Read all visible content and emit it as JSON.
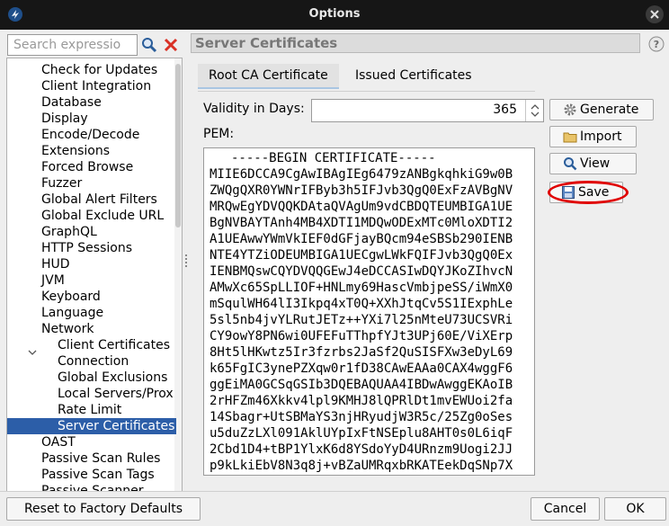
{
  "window": {
    "title": "Options"
  },
  "search": {
    "placeholder": "Search expressio"
  },
  "tree": {
    "items": [
      {
        "label": "Check for Updates"
      },
      {
        "label": "Client Integration"
      },
      {
        "label": "Database"
      },
      {
        "label": "Display"
      },
      {
        "label": "Encode/Decode"
      },
      {
        "label": "Extensions"
      },
      {
        "label": "Forced Browse"
      },
      {
        "label": "Fuzzer"
      },
      {
        "label": "Global Alert Filters"
      },
      {
        "label": "Global Exclude URL"
      },
      {
        "label": "GraphQL"
      },
      {
        "label": "HTTP Sessions"
      },
      {
        "label": "HUD"
      },
      {
        "label": "JVM"
      },
      {
        "label": "Keyboard"
      },
      {
        "label": "Language"
      },
      {
        "label": "Network",
        "expanded": true
      },
      {
        "label": "Client Certificates"
      },
      {
        "label": "Connection"
      },
      {
        "label": "Global Exclusions"
      },
      {
        "label": "Local Servers/Prox"
      },
      {
        "label": "Rate Limit"
      },
      {
        "label": "Server Certificates",
        "selected": true
      },
      {
        "label": "OAST"
      },
      {
        "label": "Passive Scan Rules"
      },
      {
        "label": "Passive Scan Tags"
      },
      {
        "label": "Passive Scanner"
      }
    ]
  },
  "panel": {
    "title": "Server Certificates",
    "tabs": [
      {
        "label": "Root CA Certificate",
        "active": true
      },
      {
        "label": "Issued Certificates",
        "active": false
      }
    ],
    "validity_label": "Validity in Days:",
    "validity_value": "365",
    "pem_label": "PEM:",
    "pem_lines": [
      "-----BEGIN CERTIFICATE-----",
      "MIIE6DCCA9CgAwIBAgIEg6479zANBgkqhkiG9w0B",
      "ZWQgQXR0YWNrIFByb3h5IFJvb3QgQ0ExFzAVBgNV",
      "MRQwEgYDVQQKDAtaQVAgUm9vdCBDQTEUMBIGA1UE",
      "BgNVBAYTAnh4MB4XDTI1MDQwODExMTc0MloXDTI2",
      "A1UEAwwYWmVkIEF0dGFjayBQcm94eSBSb290IENB",
      "NTE4YTZiODEUMBIGA1UECgwLWkFQIFJvb3QgQ0Ex",
      "IENBMQswCQYDVQQGEwJ4eDCCASIwDQYJKoZIhvcN",
      "AMwXc65SpLLIOF+HNLmy69HascVmbjpeSS/iWmX0",
      "mSqulWH64lI3Ikpq4xT0Q+XXhJtqCv5S1IExphLe",
      "5sl5nb4jvYLRutJETz++YXi7l25nMteU73UCSVRi",
      "CY9owY8PN6wi0UFEFuTThpfYJt3UPj60E/ViXErp",
      "8Ht5lHKwtz5Ir3fzrbs2JaSf2QuSISFXw3eDyL69",
      "k65FgIC3ynePZXqw0r1fD38CAwEAAa0CAX4wggF6",
      "ggEiMA0GCSqGSIb3DQEBAQUAA4IBDwAwggEKAoIB",
      "2rHFZm46Xkkv4lpl9KMHJ8lQPRlDt1mvEWUoi2fa",
      "14Sbagr+UtSBMaYS3njHRyudjW3R5c/25Zg0oSes",
      "u5duZzLXl091AklUYpIxFtNSEplu8AHT0s0L6iqF",
      "2Cbd1D4+tBP1YlxK6d8YSdoYyD4URnzm9Uogi2JJ",
      "p9kLkiEbV8N3q8j+vBZaUMRqxbRKATEekDqSNp7X"
    ],
    "buttons": {
      "generate": "Generate",
      "import": "Import",
      "view": "View",
      "save": "Save"
    }
  },
  "footer": {
    "reset": "Reset to Factory Defaults",
    "cancel": "Cancel",
    "ok": "OK"
  },
  "colors": {
    "selection": "#2c5ea8",
    "highlight_ring": "#e00000"
  }
}
